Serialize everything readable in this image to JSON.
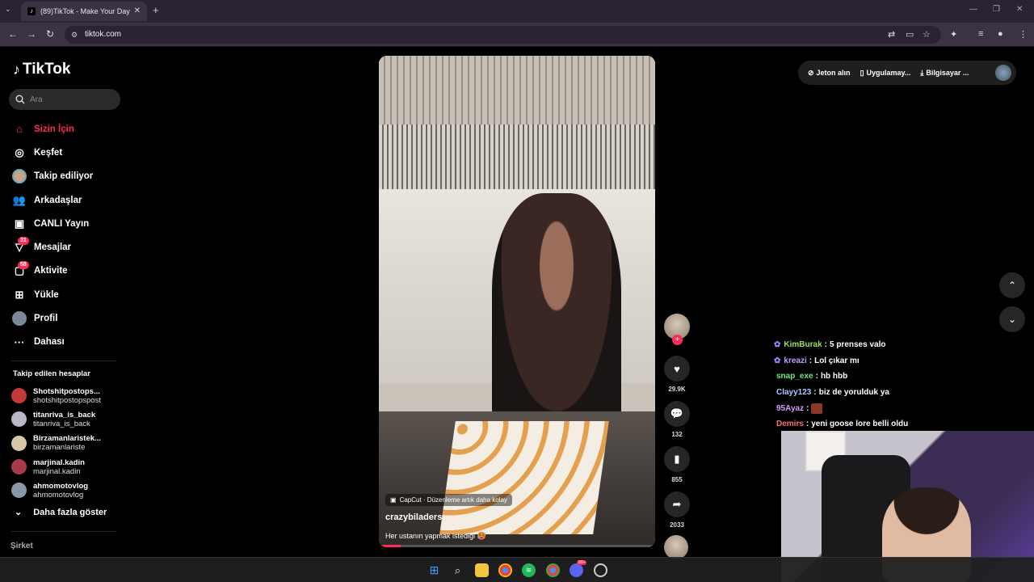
{
  "browser": {
    "tab_title": "(89)TikTok - Make Your Day",
    "url": "tiktok.com"
  },
  "app": {
    "logo": "TikTok"
  },
  "search": {
    "placeholder": "Ara"
  },
  "nav": [
    {
      "label": "Sizin İçin",
      "icon": "home-icon",
      "active": true
    },
    {
      "label": "Keşfet",
      "icon": "compass-icon"
    },
    {
      "label": "Takip ediliyor",
      "icon": "following-avatar-icon"
    },
    {
      "label": "Arkadaşlar",
      "icon": "friends-icon"
    },
    {
      "label": "CANLI Yayın",
      "icon": "live-icon"
    },
    {
      "label": "Mesajlar",
      "icon": "messages-icon",
      "badge": "31"
    },
    {
      "label": "Aktivite",
      "icon": "activity-icon",
      "badge": "58"
    },
    {
      "label": "Yükle",
      "icon": "upload-icon"
    },
    {
      "label": "Profil",
      "icon": "profile-avatar-icon"
    },
    {
      "label": "Dahası",
      "icon": "more-dots-icon"
    }
  ],
  "following": {
    "title": "Takip edilen hesaplar",
    "accounts": [
      {
        "name": "Shotshitpostops...",
        "handle": "shotshitpostopspost",
        "color": "#c43a3a"
      },
      {
        "name": "titanriva_is_back",
        "handle": "titanriva_is_back",
        "color": "#b8b8c8"
      },
      {
        "name": "Birzamanlaristek...",
        "handle": "birzamanlariste",
        "color": "#d8c8a8"
      },
      {
        "name": "marjinal.kadin",
        "handle": "marjinal.kadin",
        "color": "#a83a4a"
      },
      {
        "name": "ahmomotovlog",
        "handle": "ahmomotovlog",
        "color": "#8898a8"
      }
    ],
    "show_more": "Daha fazla göster"
  },
  "footer": {
    "company": "Şirket"
  },
  "video": {
    "capcut": "CapCut · Düzenleme artık daha kolay",
    "username": "crazybiladers",
    "description": "Her ustanın yapmak istediği 🥵",
    "progress": 0.08
  },
  "actions": {
    "likes": "29.9K",
    "comments": "132",
    "saves": "855",
    "shares": "2033"
  },
  "top_right": {
    "coins": "Jeton alın",
    "app": "Uygulamay...",
    "pc": "Bilgisayar ..."
  },
  "chat": [
    {
      "user": "KimBurak",
      "msg": "5 prenses valo",
      "color": "#9ee05a",
      "icon": "butterfly-icon"
    },
    {
      "user": "kreazi",
      "msg": "Lol çıkar mı",
      "color": "#c59bff",
      "icon": "butterfly-icon"
    },
    {
      "user": "snap_exe",
      "msg": "hb hbb",
      "color": "#6ee87c",
      "icon": ""
    },
    {
      "user": "Clayy123",
      "msg": "biz de yorulduk ya",
      "color": "#a8c8ff",
      "icon": ""
    },
    {
      "user": "95Ayaz",
      "msg": "",
      "color": "#d99bff",
      "icon": ""
    },
    {
      "user": "Demirs",
      "msg": "yeni goose lore belli oldu",
      "color": "#ff7070",
      "icon": ""
    }
  ],
  "taskbar": {
    "discord_badge": "99+"
  }
}
